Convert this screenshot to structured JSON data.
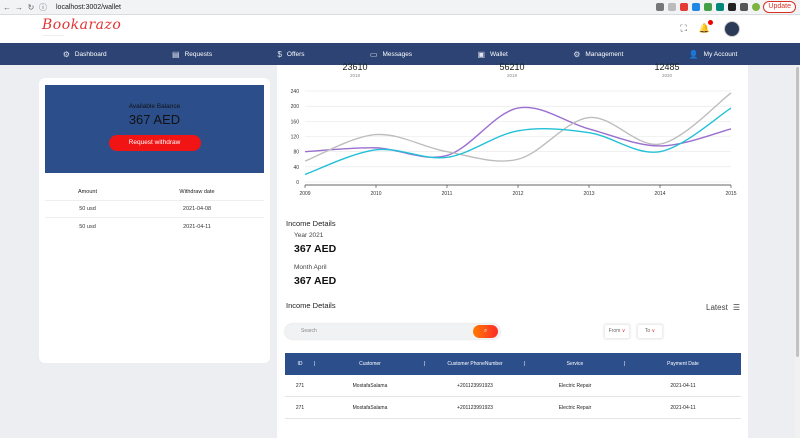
{
  "browser": {
    "url": "localhost:3002/wallet",
    "update_label": "Update"
  },
  "header": {
    "logo_text": "Bookarazo",
    "logo_tag": "___________"
  },
  "nav": {
    "items": [
      {
        "label": "Dashboard",
        "icon": "dashboard-icon"
      },
      {
        "label": "Requests",
        "icon": "clipboard-icon"
      },
      {
        "label": "Offers",
        "icon": "offer-icon"
      },
      {
        "label": "Messages",
        "icon": "message-icon"
      },
      {
        "label": "Wallet",
        "icon": "wallet-icon"
      },
      {
        "label": "Management",
        "icon": "gears-icon"
      },
      {
        "label": "My Account",
        "icon": "user-icon"
      }
    ]
  },
  "balance": {
    "label": "Available Balance",
    "amount": "367 AED",
    "button": "Request withdraw"
  },
  "withdraw_table": {
    "headers": [
      "Amount",
      "Withdraw date"
    ],
    "rows": [
      [
        "50 usd",
        "2021-04-08"
      ],
      [
        "50 usd",
        "2021-04-11"
      ]
    ]
  },
  "stats": [
    {
      "value": "23610",
      "year": "2018"
    },
    {
      "value": "56210",
      "year": "2019"
    },
    {
      "value": "12485",
      "year": "2020"
    }
  ],
  "chart_data": {
    "type": "line",
    "x": [
      2009,
      2010,
      2011,
      2012,
      2013,
      2014,
      2015
    ],
    "ylim": [
      0,
      240
    ],
    "yticks": [
      0,
      40,
      80,
      120,
      160,
      200,
      240
    ],
    "series": [
      {
        "color": "#9b6fd0",
        "values": [
          80,
          90,
          70,
          195,
          140,
          95,
          140
        ]
      },
      {
        "color": "#bdbdbd",
        "values": [
          55,
          125,
          80,
          60,
          170,
          100,
          235
        ]
      },
      {
        "color": "#21c0d8",
        "values": [
          20,
          85,
          65,
          135,
          130,
          80,
          195
        ]
      }
    ]
  },
  "income": {
    "title": "Income Details",
    "year_label": "Year 2021",
    "year_amount": "367 AED",
    "month_label": "Month April",
    "month_amount": "367 AED",
    "title2": "Income Details",
    "latest_label": "Latest",
    "search_placeholder": "Search",
    "from_label": "From",
    "to_label": "To"
  },
  "income_table": {
    "headers": [
      "ID",
      "Customer",
      "Customer PhoneNumber",
      "Service",
      "Payment Date"
    ],
    "rows": [
      [
        "271",
        "MostafaSalama",
        "+201123991923",
        "Electric Repair",
        "2021-04-11"
      ],
      [
        "271",
        "MostafaSalama",
        "+201123991923",
        "Electric Repair",
        "2021-04-11"
      ]
    ]
  }
}
